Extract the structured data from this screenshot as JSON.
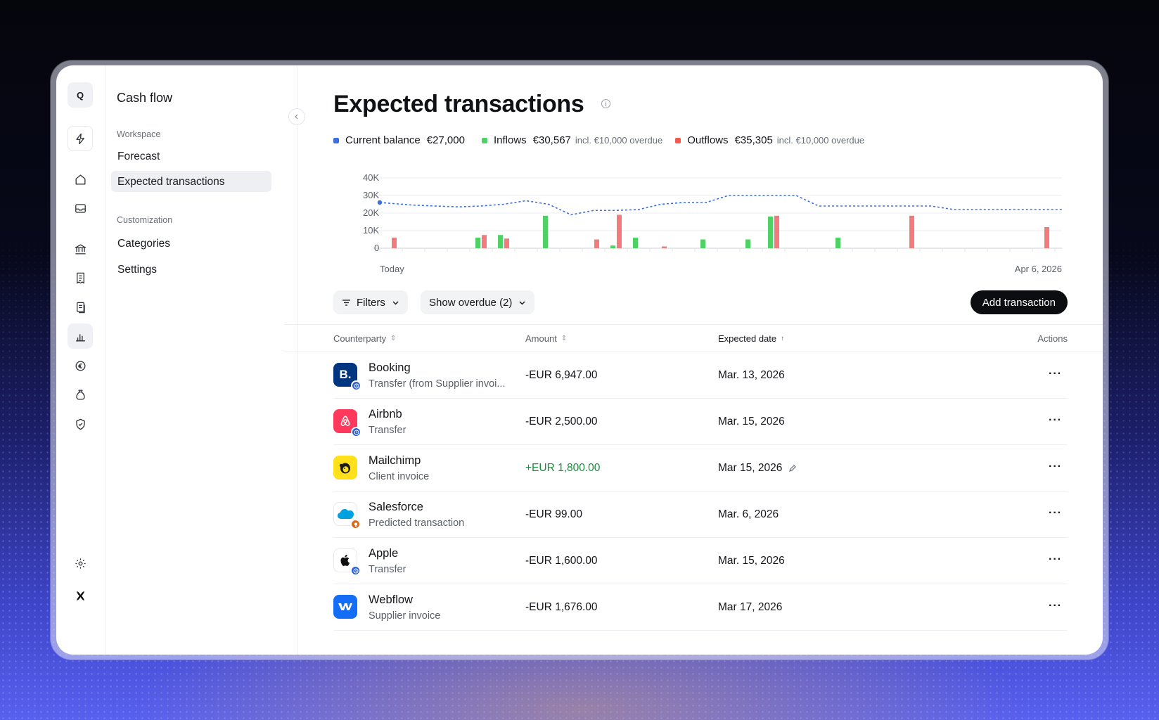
{
  "sidebar": {
    "title": "Cash flow",
    "workspace_label": "Workspace",
    "items": [
      {
        "label": "Forecast"
      },
      {
        "label": "Expected transactions"
      }
    ],
    "customization_label": "Customization",
    "custom_items": [
      {
        "label": "Categories"
      },
      {
        "label": "Settings"
      }
    ]
  },
  "rail": {
    "logo": "Q",
    "icons": [
      "bolt-icon",
      "home-icon",
      "inbox-icon",
      "bank-icon",
      "receipt-icon",
      "documents-icon",
      "chart-icon",
      "euro-icon",
      "pouch-icon",
      "shield-icon",
      "gear-icon",
      "brand-icon"
    ]
  },
  "main": {
    "title": "Expected transactions",
    "legend": {
      "balance_label": "Current balance",
      "balance_value": "€27,000",
      "inflows_label": "Inflows",
      "inflows_value": "€30,567",
      "inflows_note": "incl. €10,000 overdue",
      "outflows_label": "Outflows",
      "outflows_value": "€35,305",
      "outflows_note": "incl. €10,000 overdue"
    },
    "filters_label": "Filters",
    "overdue_label": "Show overdue (2)",
    "add_label": "Add transaction"
  },
  "colors": {
    "balance": "#3b6fe0",
    "inflow": "#4fd166",
    "outflow": "#f27b7b",
    "positive_amount": "#1a8b3c"
  },
  "chart_data": {
    "type": "bar",
    "x_start_label": "Today",
    "x_end_label": "Apr 6, 2026",
    "ylim": [
      0,
      40000
    ],
    "y_ticks": [
      "0",
      "10K",
      "20K",
      "30K",
      "40K"
    ],
    "slots": 30,
    "series": [
      {
        "name": "Inflows",
        "values": [
          0,
          0,
          0,
          0,
          6000,
          7500,
          0,
          18500,
          0,
          0,
          1500,
          6000,
          0,
          0,
          5000,
          0,
          5000,
          18000,
          0,
          0,
          6000,
          0,
          0,
          0,
          0,
          0,
          0,
          0,
          0,
          0
        ]
      },
      {
        "name": "Outflows",
        "values": [
          6000,
          0,
          0,
          0,
          7500,
          5500,
          0,
          0,
          0,
          5000,
          19000,
          0,
          1000,
          0,
          0,
          0,
          0,
          18500,
          0,
          0,
          0,
          0,
          0,
          18500,
          0,
          0,
          0,
          0,
          0,
          12000
        ]
      },
      {
        "name": "Current balance",
        "values": [
          26000,
          24500,
          24000,
          23500,
          24000,
          25000,
          27000,
          25000,
          19000,
          21500,
          21500,
          22000,
          25000,
          26000,
          26000,
          30000,
          30000,
          30000,
          30000,
          24000,
          24000,
          24000,
          24000,
          24000,
          24000,
          22000,
          22000,
          22000,
          22000,
          22000
        ]
      }
    ]
  },
  "table": {
    "headers": {
      "counterparty": "Counterparty",
      "amount": "Amount",
      "date": "Expected date",
      "actions": "Actions"
    },
    "rows": [
      {
        "name": "Booking",
        "sub": "Transfer (from Supplier invoi...",
        "amount": "-EUR 6,947.00",
        "date": "Mar. 13, 2026",
        "logo": "B.",
        "logo_bg": "#003580",
        "badge": "clock-icon",
        "badge_bg": "#2a5fd6"
      },
      {
        "name": "Airbnb",
        "sub": "Transfer",
        "amount": "-EUR 2,500.00",
        "date": "Mar. 15, 2026",
        "logo": "⌂",
        "logo_bg": "#ff385c",
        "badge": "clock-icon",
        "badge_bg": "#2a5fd6"
      },
      {
        "name": "Mailchimp",
        "sub": "Client invoice",
        "amount": "+EUR 1,800.00",
        "date": "Mar 15, 2026",
        "logo": "☺",
        "logo_bg": "#ffe01b",
        "badge": "",
        "badge_bg": ""
      },
      {
        "name": "Salesforce",
        "sub": "Predicted transaction",
        "amount": "-EUR 99.00",
        "date": "Mar. 6, 2026",
        "logo": "salesforce",
        "logo_bg": "#ffffff",
        "badge": "bulb-icon",
        "badge_bg": "#d96b1a"
      },
      {
        "name": "Apple",
        "sub": "Transfer",
        "amount": "-EUR 1,600.00",
        "date": "Mar. 15, 2026",
        "logo": "",
        "logo_bg": "#ffffff",
        "badge": "clock-icon",
        "badge_bg": "#2a5fd6"
      },
      {
        "name": "Webflow",
        "sub": "Supplier invoice",
        "amount": "-EUR 1,676.00",
        "date": "Mar 17, 2026",
        "logo": "W",
        "logo_bg": "#146ef5",
        "badge": "",
        "badge_bg": ""
      }
    ],
    "actions_glyph": "···"
  }
}
